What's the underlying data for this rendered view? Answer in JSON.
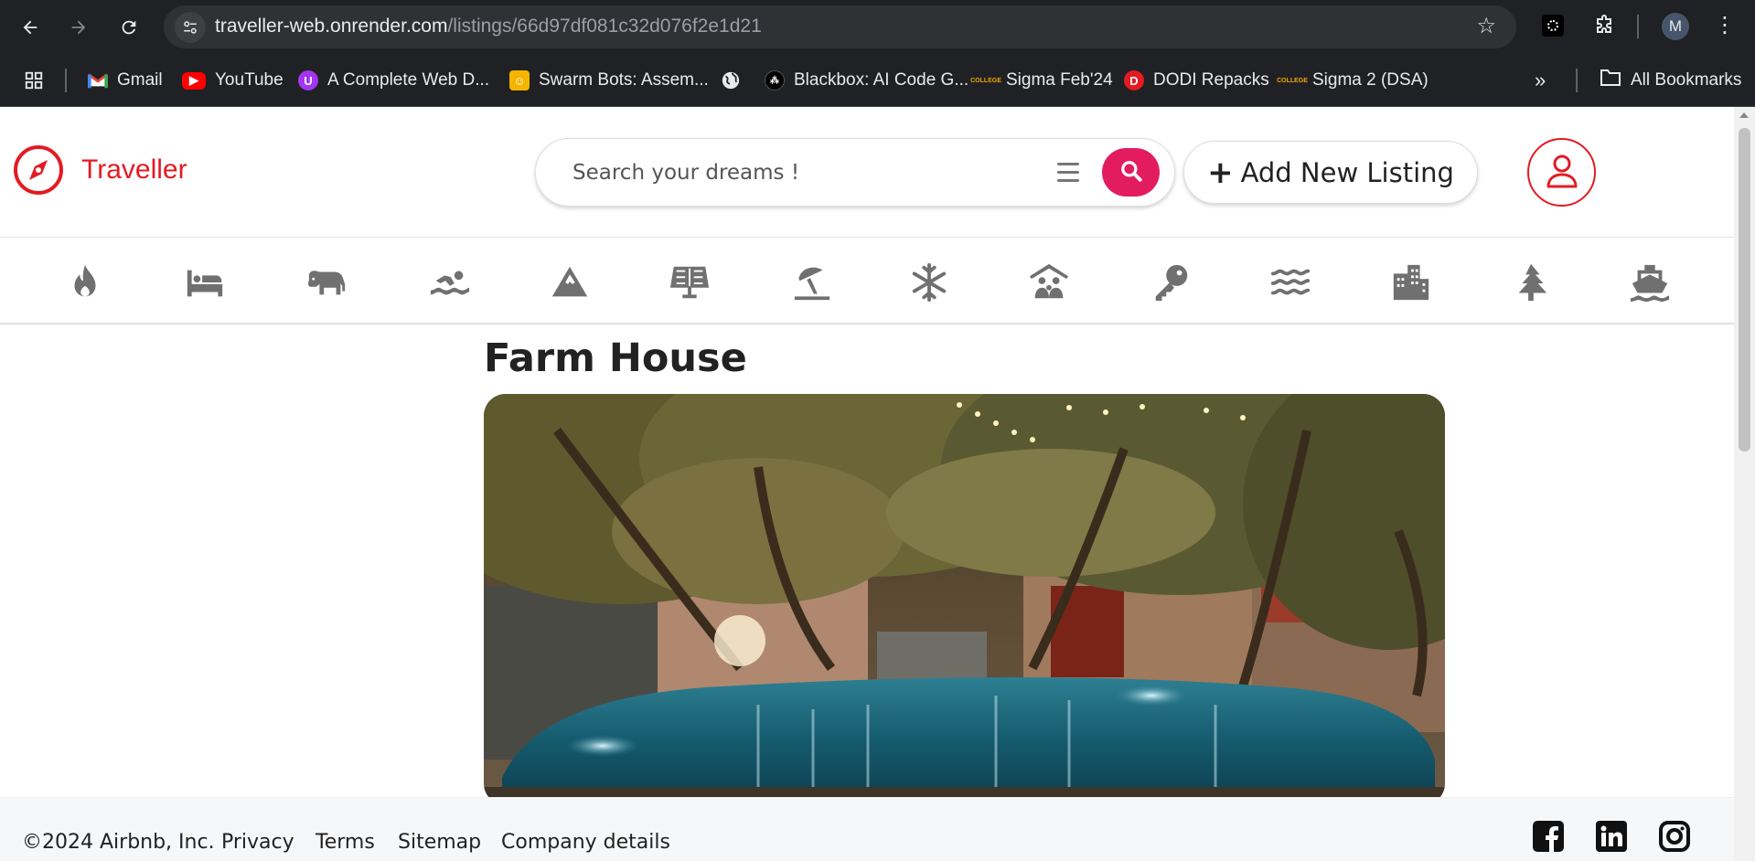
{
  "browser": {
    "url_host": "traveller-web.onrender.com",
    "url_path": "/listings/66d97df081c32d076f2e1d21",
    "profile_initial": "M",
    "bookmarks": [
      {
        "label": "Gmail",
        "icon": "gmail-icon",
        "color": "#ea4335"
      },
      {
        "label": "YouTube",
        "icon": "youtube-icon",
        "color": "#ff0000"
      },
      {
        "label": "A Complete Web D...",
        "icon": "udemy-icon",
        "color": "#a435f0"
      },
      {
        "label": "Swarm Bots: Assem...",
        "icon": "swarm-icon",
        "color": "#f5b400"
      },
      {
        "label": "",
        "icon": "globe-icon",
        "color": "#e8eaed"
      },
      {
        "label": "Blackbox: AI Code G...",
        "icon": "blackbox-icon",
        "color": "#000000"
      },
      {
        "label": "Sigma Feb'24",
        "icon": "college-icon",
        "color": "#f0a500"
      },
      {
        "label": "DODI Repacks",
        "icon": "dodi-icon",
        "color": "#e31b23"
      },
      {
        "label": "Sigma 2 (DSA)",
        "icon": "college-icon",
        "color": "#f0a500"
      }
    ],
    "all_bookmarks_label": "All Bookmarks"
  },
  "header": {
    "brand": "Traveller",
    "brand_color": "#e31b23",
    "search_placeholder": "Search your dreams !",
    "search_button_color": "#e31c5f",
    "add_listing_label": "Add New Listing"
  },
  "filters": [
    {
      "name": "trending",
      "icon": "fire-icon"
    },
    {
      "name": "rooms",
      "icon": "bed-icon"
    },
    {
      "name": "farms",
      "icon": "cow-icon"
    },
    {
      "name": "pools",
      "icon": "swimmer-icon"
    },
    {
      "name": "mountains",
      "icon": "mountain-icon"
    },
    {
      "name": "solar",
      "icon": "solar-panel-icon"
    },
    {
      "name": "beach",
      "icon": "umbrella-beach-icon"
    },
    {
      "name": "arctic",
      "icon": "snowflake-icon"
    },
    {
      "name": "family",
      "icon": "people-roof-icon"
    },
    {
      "name": "rentals",
      "icon": "key-icon"
    },
    {
      "name": "lakes",
      "icon": "water-icon"
    },
    {
      "name": "cities",
      "icon": "city-icon"
    },
    {
      "name": "forests",
      "icon": "tree-icon"
    },
    {
      "name": "boats",
      "icon": "ship-icon"
    }
  ],
  "listing": {
    "title": "Farm House"
  },
  "footer": {
    "copyright": "©2024 Airbnb, Inc.",
    "links": [
      "Privacy",
      "Terms",
      "Sitemap",
      "Company details"
    ],
    "social": [
      "facebook-icon",
      "linkedin-icon",
      "instagram-icon"
    ]
  }
}
